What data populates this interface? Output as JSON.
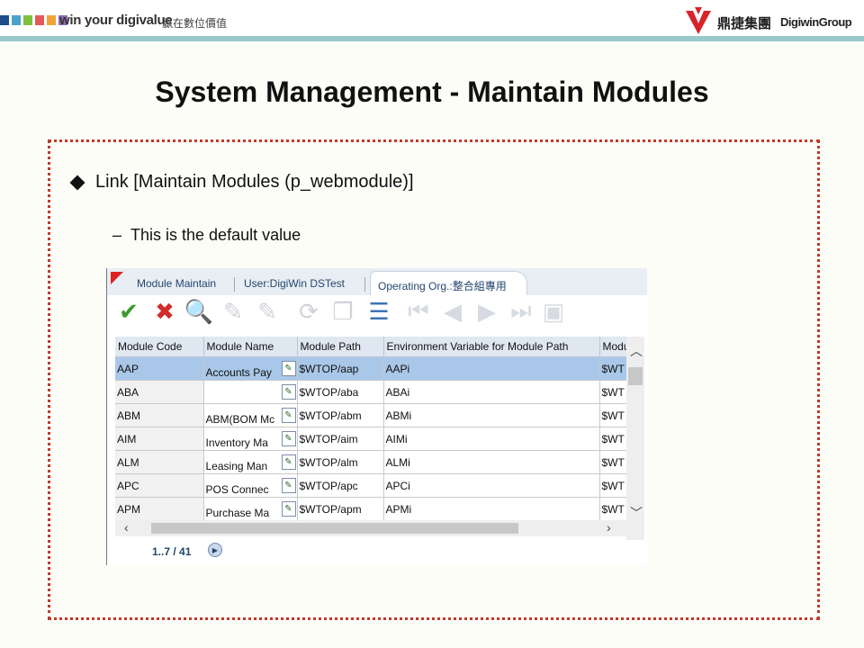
{
  "header": {
    "slogan": "win your digivalue",
    "slogan_cn": "贏在數位價值",
    "group_cn": "鼎捷集團",
    "group_en": "DigiwinGroup",
    "square_colors": [
      "#1b4f8c",
      "#4aa3c8",
      "#7fbf3f",
      "#e35a5a",
      "#f1a33a",
      "#8f6bb3"
    ]
  },
  "slide": {
    "title": "System Management - Maintain Modules",
    "bullet": "Link [Maintain Modules (p_webmodule)]",
    "sub_dash": "–",
    "subbullet": "This is the default value"
  },
  "app": {
    "tabs": [
      "Module Maintain",
      "User:DigiWin DSTest",
      "Operating Org.:整合組專用"
    ],
    "toolbar": [
      {
        "name": "confirm-check-icon",
        "glyph": "✔",
        "color": "#3a9a2e"
      },
      {
        "name": "cancel-x-icon",
        "glyph": "✖",
        "color": "#d22b2b"
      },
      {
        "name": "search-magnifier-icon",
        "glyph": "🔍",
        "color": "#2c6fb5"
      },
      {
        "name": "pencil-icon",
        "glyph": "✎",
        "color": "#cfd3d8"
      },
      {
        "name": "edit-doc-icon",
        "glyph": "✎",
        "color": "#cfd3d8"
      },
      {
        "name": "refresh-icon",
        "glyph": "⟳",
        "color": "#cfd3d8"
      },
      {
        "name": "copy-icon",
        "glyph": "❐",
        "color": "#cfd3d8"
      },
      {
        "name": "grid-view-icon",
        "glyph": "☰",
        "color": "#3b73b4"
      },
      {
        "name": "first-record-icon",
        "glyph": "⏮",
        "color": "#d6dbe2"
      },
      {
        "name": "previous-record-icon",
        "glyph": "◀",
        "color": "#d6dbe2"
      },
      {
        "name": "next-record-icon",
        "glyph": "▶",
        "color": "#d6dbe2"
      },
      {
        "name": "last-record-icon",
        "glyph": "⏭",
        "color": "#d6dbe2"
      },
      {
        "name": "export-icon",
        "glyph": "▣",
        "color": "#d6dbe2"
      }
    ],
    "columns": [
      "Module Code",
      "Module Name",
      "Module Path",
      "Environment Variable for Module Path",
      "Modu"
    ],
    "rows": [
      {
        "code": "AAP",
        "name": "Accounts Pay",
        "path": "$WTOP/aap",
        "env": "AAPi",
        "mod": "$WT"
      },
      {
        "code": "ABA",
        "name": "",
        "path": "$WTOP/aba",
        "env": "ABAi",
        "mod": "$WT"
      },
      {
        "code": "ABM",
        "name": "ABM(BOM Mc",
        "path": "$WTOP/abm",
        "env": "ABMi",
        "mod": "$WT"
      },
      {
        "code": "AIM",
        "name": "Inventory Ma",
        "path": "$WTOP/aim",
        "env": "AIMi",
        "mod": "$WT"
      },
      {
        "code": "ALM",
        "name": "Leasing Man",
        "path": "$WTOP/alm",
        "env": "ALMi",
        "mod": "$WT"
      },
      {
        "code": "APC",
        "name": "POS Connec",
        "path": "$WTOP/apc",
        "env": "APCi",
        "mod": "$WT"
      },
      {
        "code": "APM",
        "name": "Purchase Ma",
        "path": "$WTOP/apm",
        "env": "APMi",
        "mod": "$WT"
      }
    ],
    "pager": "1..7 / 41"
  }
}
